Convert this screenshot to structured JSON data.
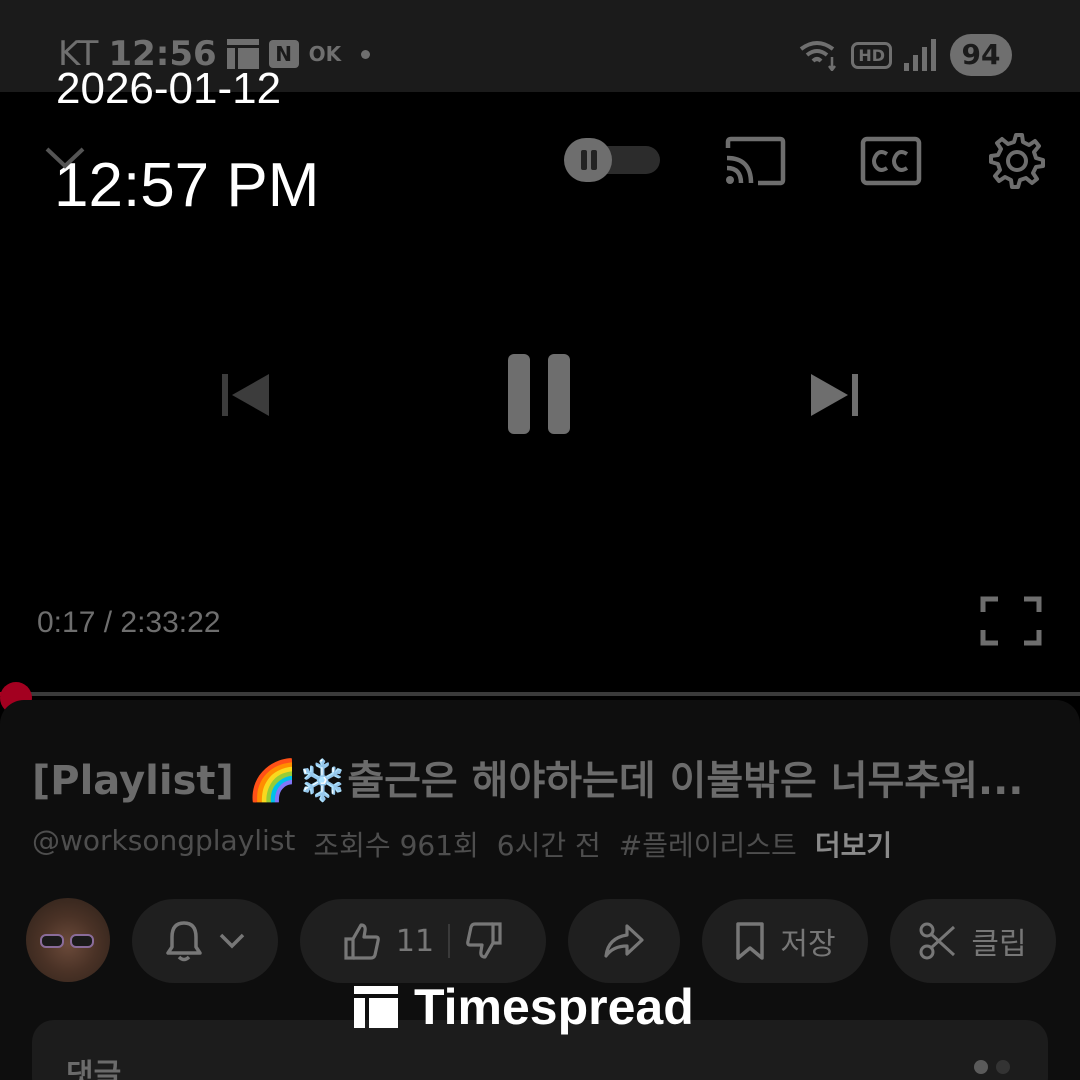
{
  "status_bar": {
    "carrier": "KT",
    "clock": "12:56",
    "ok_label": "OK",
    "hd_label": "HD",
    "battery": "94"
  },
  "stamp": {
    "date": "2026-01-12",
    "time": "12:57 PM"
  },
  "player": {
    "elapsed": "0:17",
    "duration": "2:33:22",
    "separator": " / ",
    "progress_fraction": 0.0018,
    "autoplay_state": "paused"
  },
  "video": {
    "title": "[Playlist] 🌈❄️출근은 해야하는데 이불밖은 너무추워...",
    "channel": "@worksongplaylist",
    "views": "조회수 961회",
    "age": "6시간 전",
    "hashtag": "#플레이리스트",
    "more_label": "더보기"
  },
  "actions": {
    "like_count": "11",
    "save_label": "저장",
    "clip_label": "클립"
  },
  "comments": {
    "label": "댓글"
  },
  "watermark": {
    "text": "Timespread"
  },
  "colors": {
    "accent": "#b3001e",
    "panel": "#0e0e0e",
    "pill": "#1f1f1f"
  }
}
